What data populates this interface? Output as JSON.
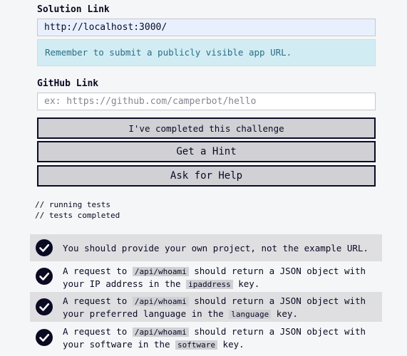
{
  "solution": {
    "label": "Solution Link",
    "value": "http://localhost:3000/"
  },
  "alert": {
    "text": "Remember to submit a publicly visible app URL."
  },
  "github": {
    "label": "GitHub Link",
    "placeholder": "ex: https://github.com/camperbot/hello"
  },
  "buttons": {
    "complete": "I've completed this challenge",
    "hint": "Get a Hint",
    "help": "Ask for Help"
  },
  "console": {
    "line1": "// running tests",
    "line2": "// tests completed"
  },
  "tests": [
    {
      "parts": [
        "You should provide your own project, not the example URL."
      ]
    },
    {
      "parts": [
        "A request to ",
        "/api/whoami",
        " should return a JSON object with your IP address in the ",
        "ipaddress",
        " key."
      ]
    },
    {
      "parts": [
        "A request to ",
        "/api/whoami",
        " should return a JSON object with your preferred language in the ",
        "language",
        " key."
      ]
    },
    {
      "parts": [
        "A request to ",
        "/api/whoami",
        " should return a JSON object with your software in the ",
        "software",
        " key."
      ]
    }
  ],
  "icons": {
    "check": "check-circle-icon"
  },
  "colors": {
    "background": "#f5f6f7",
    "text": "#0a0a23",
    "alert_bg": "#d2ecf4",
    "alert_text": "#2a6f84",
    "button_bg": "#d0d0d5",
    "input_filled_bg": "#e8f0fe",
    "test_shaded_bg": "#dfdfe2"
  }
}
